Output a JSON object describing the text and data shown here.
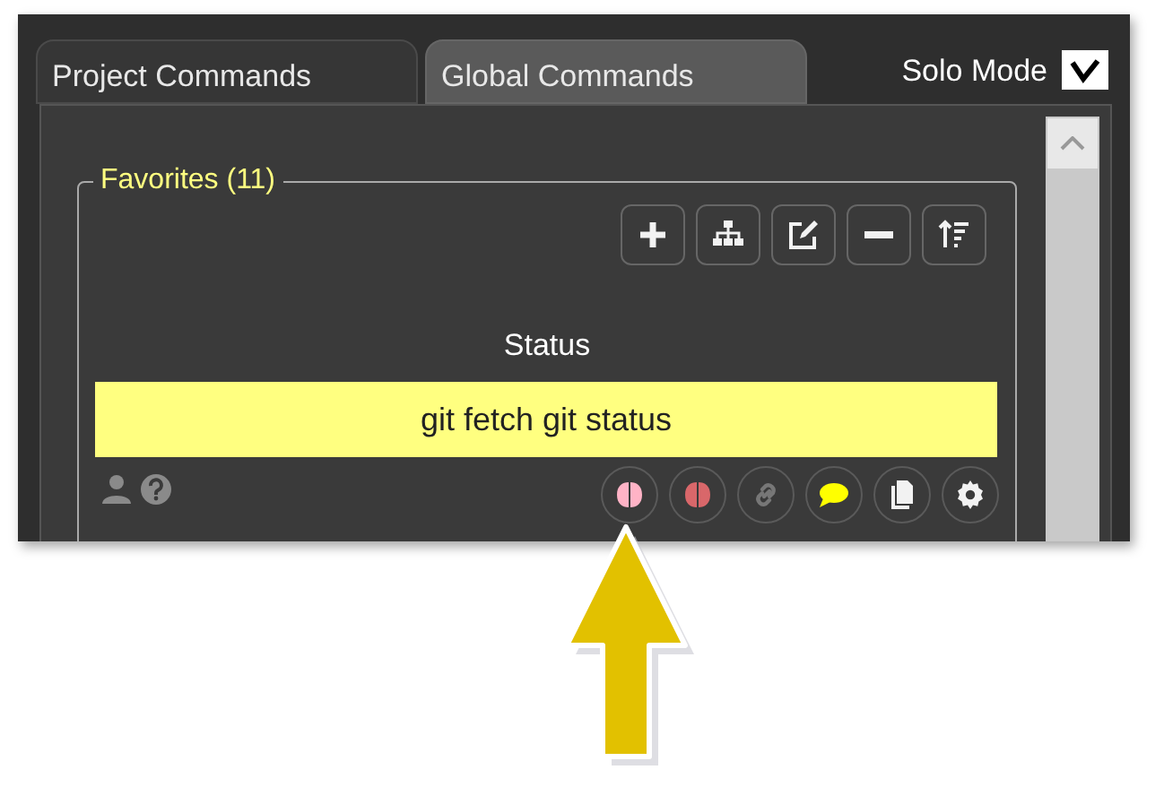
{
  "tabs": [
    {
      "label": "Project Commands",
      "selected": false
    },
    {
      "label": "Global Commands",
      "selected": true
    }
  ],
  "solo_mode": {
    "label": "Solo Mode",
    "checked": true
  },
  "favorites": {
    "title": "Favorites (11)",
    "toolbar": [
      {
        "kind": "add"
      },
      {
        "kind": "tree"
      },
      {
        "kind": "edit"
      },
      {
        "kind": "remove"
      },
      {
        "kind": "sort"
      }
    ],
    "command": {
      "name": "Status",
      "text": "git fetch git status"
    },
    "info_icons": [
      {
        "kind": "user"
      },
      {
        "kind": "help"
      }
    ],
    "actions": [
      {
        "kind": "brain-pink"
      },
      {
        "kind": "brain-red"
      },
      {
        "kind": "link"
      },
      {
        "kind": "comment"
      },
      {
        "kind": "copy"
      },
      {
        "kind": "gear"
      }
    ]
  }
}
